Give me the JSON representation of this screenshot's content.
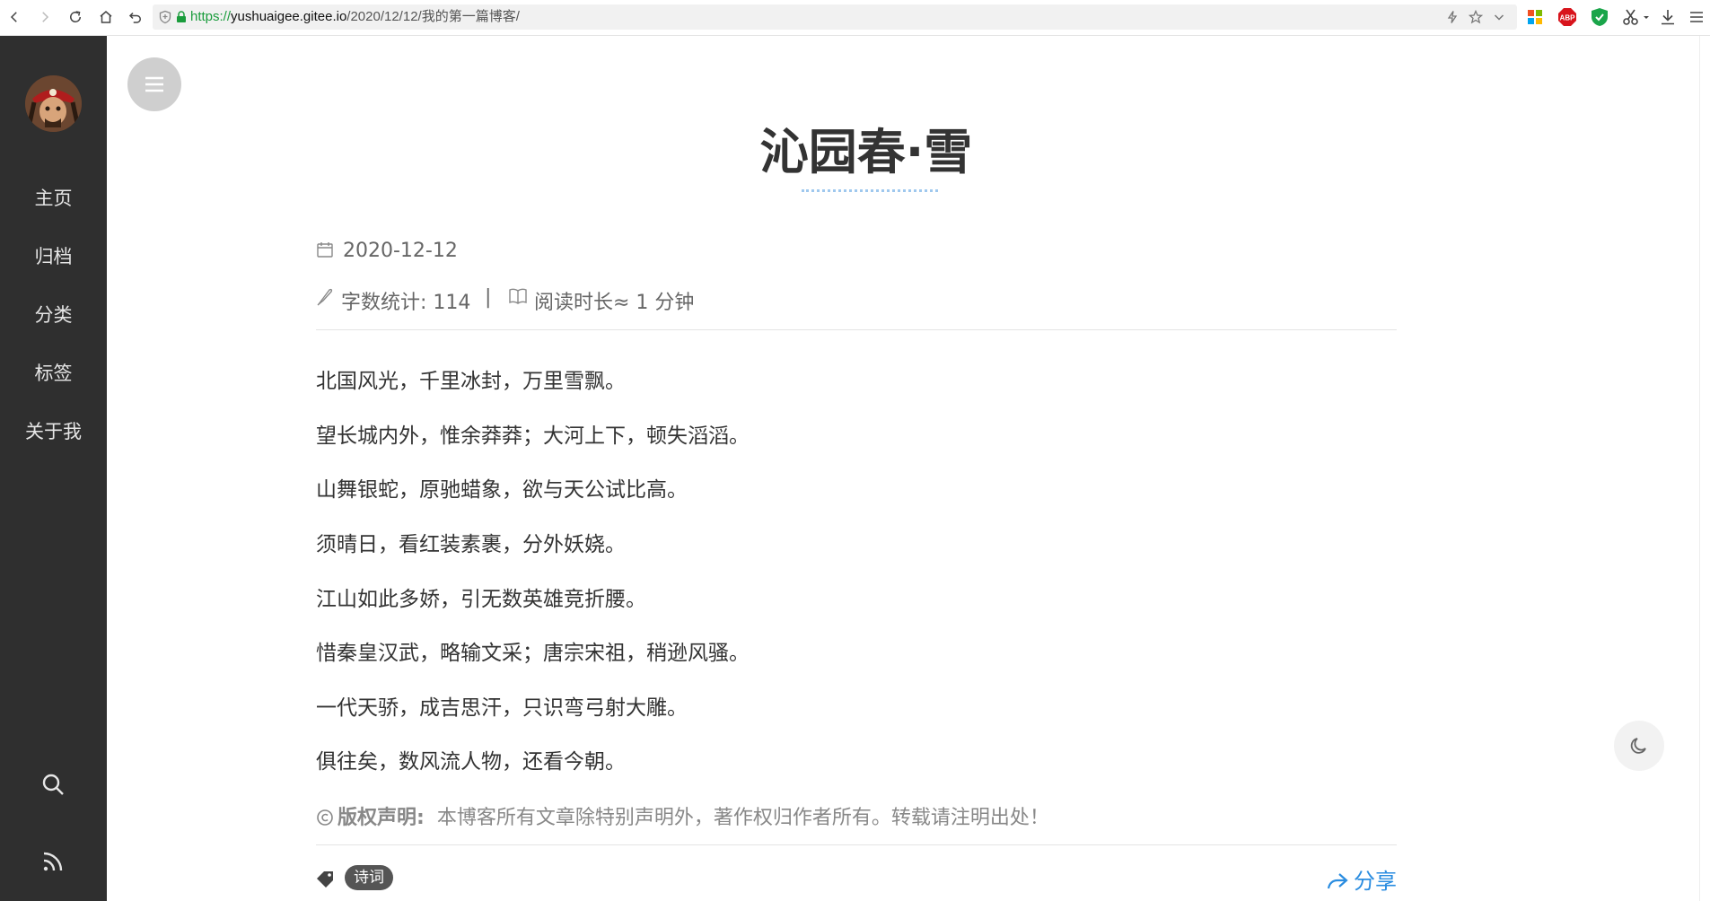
{
  "browser": {
    "url_scheme": "https://",
    "url_host": "yushuaigee.gitee.io",
    "url_path": "/2020/12/12/我的第一篇博客/"
  },
  "sidebar": {
    "items": [
      {
        "label": "主页"
      },
      {
        "label": "归档"
      },
      {
        "label": "分类"
      },
      {
        "label": "标签"
      },
      {
        "label": "关于我"
      }
    ],
    "search_icon": "search-icon",
    "rss_icon": "rss-icon"
  },
  "post": {
    "title": "沁园春·雪",
    "date": "2020-12-12",
    "word_count": "字数统计: 114",
    "separator": "|",
    "reading_time": "阅读时长≈ 1 分钟",
    "paragraphs": [
      "北国风光，千里冰封，万里雪飘。",
      "望长城内外，惟余莽莽；大河上下，顿失滔滔。",
      "山舞银蛇，原驰蜡象，欲与天公试比高。",
      "须晴日，看红装素裹，分外妖娆。",
      "江山如此多娇，引无数英雄竞折腰。",
      "惜秦皇汉武，略输文采；唐宗宋祖，稍逊风骚。",
      "一代天骄，成吉思汗，只识弯弓射大雕。",
      "俱往矣，数风流人物，还看今朝。"
    ],
    "copyright_label": "版权声明:",
    "copyright_text": "本博客所有文章除特别声明外，著作权归作者所有。转载请注明出处！",
    "tag": "诗词",
    "share_label": "分享"
  },
  "colors": {
    "sidebar_bg": "#2f2f2f",
    "accent": "#2b8de0",
    "title_underline": "#9fc8ee"
  }
}
